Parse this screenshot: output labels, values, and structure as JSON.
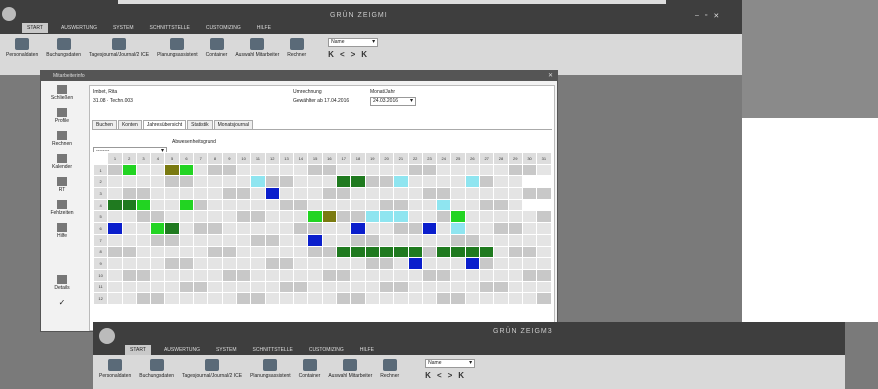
{
  "colors": {
    "cell_gray": "#c8c8c8",
    "cell_light": "#e4e4e4",
    "green_light": "#22d422",
    "green_dark": "#1f7a1f",
    "olive": "#7a7a10",
    "cyan": "#8fe5f0",
    "blue": "#0a1ecc",
    "white": "#ffffff"
  },
  "app": {
    "title": "GRÜN ZEIGMI",
    "menu": [
      "START",
      "AUSWERTUNG",
      "SYSTEM",
      "SCHNITTSTELLE",
      "CUSTOMIZING",
      "HILFE"
    ],
    "ribbon": [
      "Personaldaten",
      "Buchungsdaten",
      "Tagesjournal/Journal/2 ICE",
      "Planungsassistent",
      "Container",
      "Auswahl Mitarbeiter",
      "Rechner"
    ],
    "combo": "Name",
    "nav": [
      "K",
      "<",
      ">",
      "K"
    ]
  },
  "window_back": {
    "title": "GRÜN ZEIGM3",
    "menu": [
      "START",
      "AUSWERTUNG",
      "SYSTEM",
      "SCHNITTSTELLE",
      "CUSTOMIZING",
      "HILFE"
    ],
    "ribbon": [
      "Personaldaten",
      "Buchungsdaten",
      "Tagesjournal/Journal/2 ICE",
      "Planungsassistent",
      "Container",
      "Auswahl Mitarbeiter",
      "Rechner"
    ],
    "combo": "Name",
    "nav": [
      "K",
      "<",
      ">",
      "K"
    ]
  },
  "dialog": {
    "title": "Mitarbeiterinfo",
    "sidebar": [
      "Schließen",
      "Profile",
      "Rechnen",
      "Kalender",
      "RT",
      "Fehlzeiten",
      "Hilfe",
      "Details"
    ],
    "employee_name": "Imbet, Rita",
    "employee_id": "31.08 · Techn.003",
    "umrechnung_label": "Umrechnung",
    "umrechnung_value": "Gewählter ab 17.04.2016",
    "monat_label": "Monat/Jahr",
    "monat_value": "24.03.2016",
    "tabs": [
      "Buchen",
      "Konten",
      "Jahresübersicht",
      "Statistik",
      "Monatsjournal"
    ],
    "filter_value": "--------",
    "filter_label": "Abwesenheitsgrund",
    "days": [
      "1",
      "2",
      "3",
      "4",
      "5",
      "6",
      "7",
      "8",
      "9",
      "10",
      "11",
      "12",
      "13",
      "14",
      "15",
      "16",
      "17",
      "18",
      "19",
      "20",
      "21",
      "22",
      "23",
      "24",
      "25",
      "26",
      "27",
      "28",
      "29",
      "30",
      "31"
    ],
    "months": [
      "1",
      "2",
      "3",
      "4",
      "5",
      "6",
      "7",
      "8",
      "9",
      "10",
      "11",
      "12"
    ]
  }
}
